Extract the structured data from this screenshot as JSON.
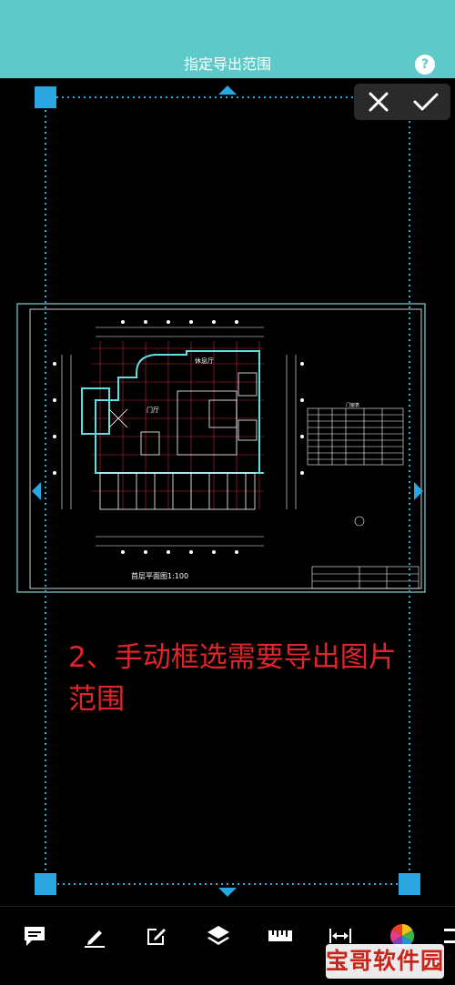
{
  "header": {
    "title": "指定导出范围",
    "help_glyph": "?"
  },
  "drawing": {
    "room_lounge": "休息厅",
    "room_lobby": "门厅",
    "caption": "首层平面图1:100",
    "door_window_table_title": "门窗表"
  },
  "instruction": {
    "line1": "2、手动框选需要导出图片",
    "line2": "范围"
  },
  "toolbar": {
    "icons": [
      "comment-icon",
      "pen-icon",
      "edit-icon",
      "layers-icon",
      "ruler-icon",
      "dimension-icon",
      "color-wheel-icon"
    ]
  },
  "watermark": {
    "text": "宝哥软件园"
  },
  "colors": {
    "header": "#5ec9c9",
    "selection": "#2aa7e0",
    "instruction": "#e0262a",
    "drawing_frame": "#7fd3d3"
  }
}
